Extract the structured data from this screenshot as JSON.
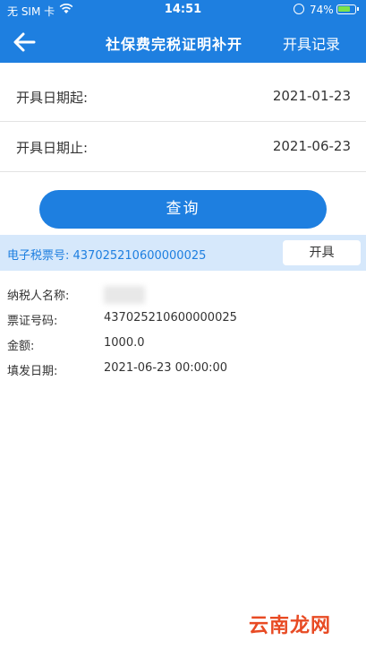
{
  "status_bar": {
    "carrier": "无 SIM 卡",
    "time": "14:51",
    "battery": "74%",
    "battery_level": 0.74
  },
  "header": {
    "title": "社保费完税证明补开",
    "records_link": "开具记录"
  },
  "filters": {
    "start_label": "开具日期起:",
    "start_value": "2021-01-23",
    "end_label": "开具日期止:",
    "end_value": "2021-06-23"
  },
  "query_button": "查询",
  "ticket": {
    "header_text": "电子税票号: 437025210600000025",
    "issue_button": "开具"
  },
  "details": {
    "taxpayer_label": "纳税人名称:",
    "ticket_no_label": "票证号码:",
    "ticket_no_value": "437025210600000025",
    "amount_label": "金额:",
    "amount_value": "1000.0",
    "date_label": "填发日期:",
    "date_value": "2021-06-23 00:00:00"
  },
  "watermark": "云南龙网",
  "colors": {
    "primary": "#1e7fe0",
    "ticket_bar": "#d6e8fb",
    "watermark": "#e84b24"
  }
}
